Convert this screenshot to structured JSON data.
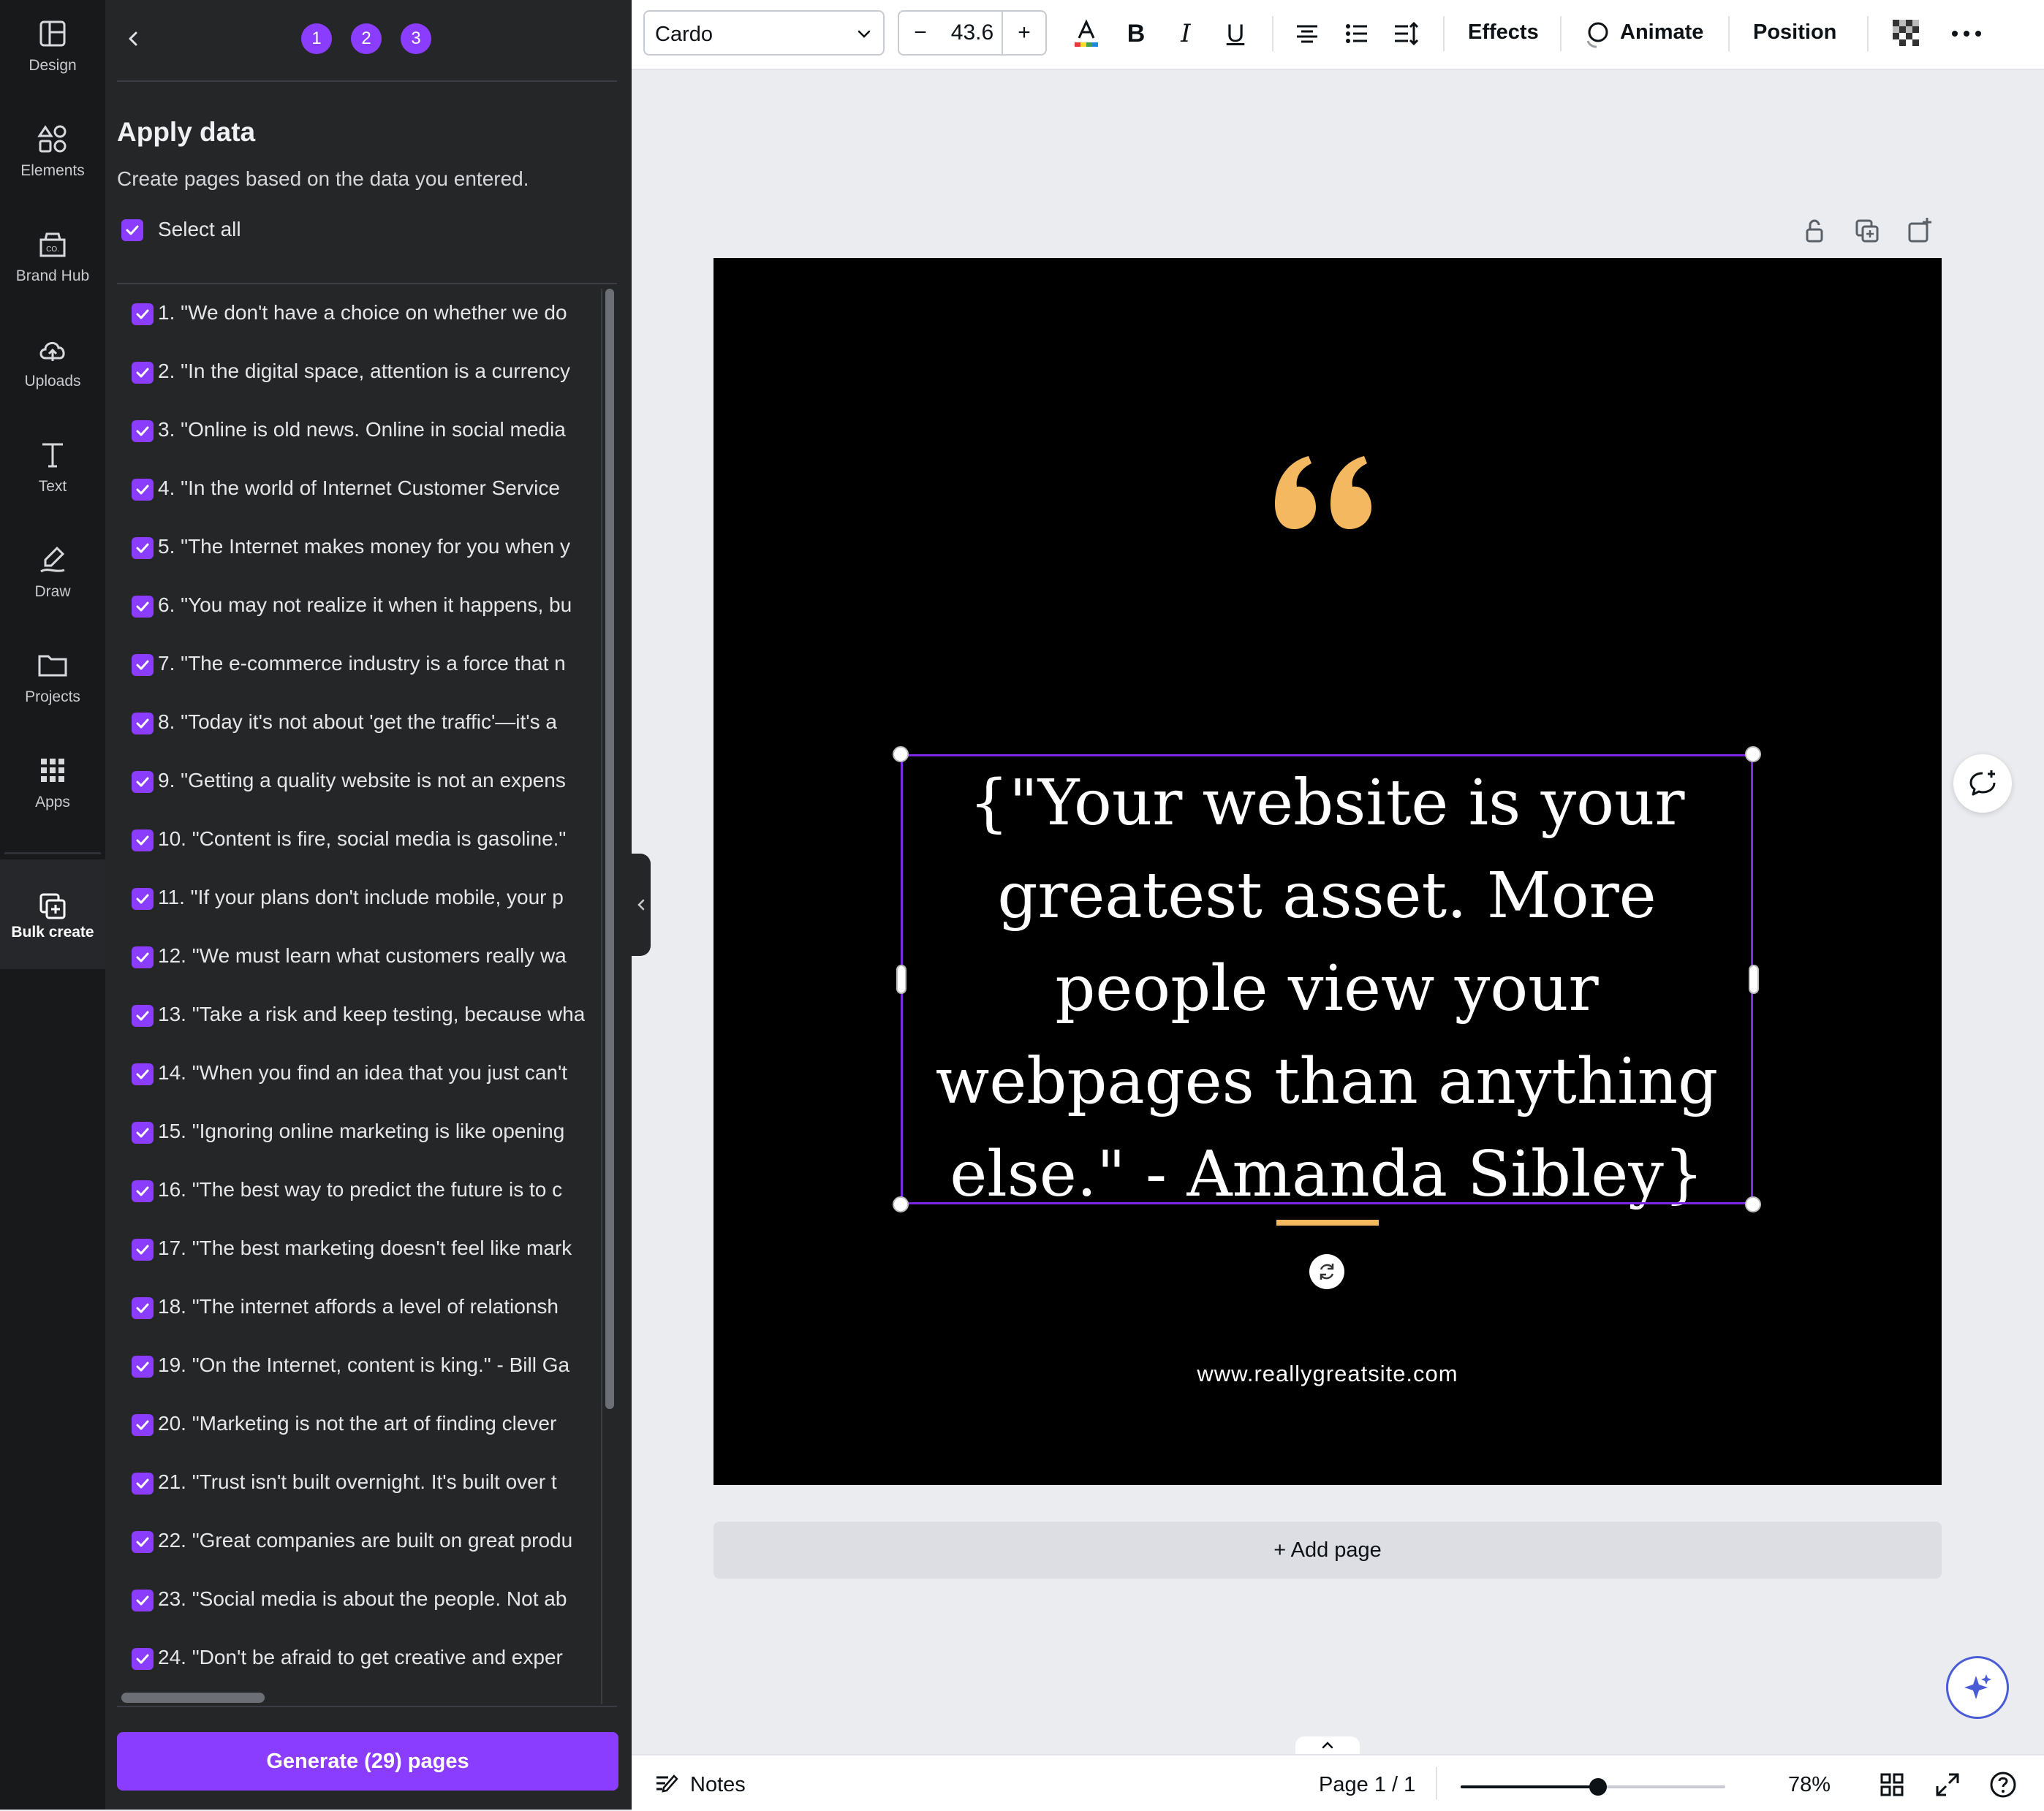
{
  "rail": {
    "items": [
      {
        "label": "Design",
        "icon": "design-layout-icon"
      },
      {
        "label": "Elements",
        "icon": "elements-shapes-icon"
      },
      {
        "label": "Brand Hub",
        "icon": "brand-hub-icon"
      },
      {
        "label": "Uploads",
        "icon": "cloud-upload-icon"
      },
      {
        "label": "Text",
        "icon": "text-t-icon"
      },
      {
        "label": "Draw",
        "icon": "pen-draw-icon"
      },
      {
        "label": "Projects",
        "icon": "folder-icon"
      },
      {
        "label": "Apps",
        "icon": "apps-grid-icon"
      }
    ],
    "active": {
      "label": "Bulk create",
      "icon": "bulk-create-icon"
    }
  },
  "panel": {
    "steps": [
      "1",
      "2",
      "3"
    ],
    "title": "Apply data",
    "subtitle": "Create pages based on the data you entered.",
    "select_all_label": "Select all",
    "rows": [
      "1. \"We don't have a choice on whether we do",
      "2. \"In the digital space, attention is a currency",
      "3. \"Online is old news. Online in social media",
      "4. \"In the world of Internet Customer Service",
      "5. \"The Internet makes money for you when y",
      "6. \"You may not realize it when it happens, bu",
      "7. \"The e-commerce industry is a force that n",
      "8. \"Today it's not about 'get the traffic'—it's a",
      "9. \"Getting a quality website is not an expens",
      "10. \"Content is fire, social media is gasoline.\"",
      "11. \"If your plans don't include mobile, your p",
      "12. \"We must learn what customers really wa",
      "13. \"Take a risk and keep testing, because wha",
      "14. \"When you find an idea that you just can't",
      "15. \"Ignoring online marketing is like opening",
      "16. \"The best way to predict the future is to c",
      "17. \"The best marketing doesn't feel like mark",
      "18. \"The internet affords a level of relationsh",
      "19. \"On the Internet, content is king.\" - Bill Ga",
      "20. \"Marketing is not the art of finding clever",
      "21. \"Trust isn't built overnight. It's built over t",
      "22. \"Great companies are built on great produ",
      "23. \"Social media is about the people. Not ab",
      "24. \"Don't be afraid to get creative and exper"
    ],
    "generate_label": "Generate (29) pages"
  },
  "toolbar": {
    "font": "Cardo",
    "font_size": "43.6",
    "minus": "−",
    "plus": "+",
    "bold": "B",
    "italic": "I",
    "underline": "U",
    "effects": "Effects",
    "animate": "Animate",
    "position": "Position"
  },
  "canvas": {
    "quote": "{\"Your website is your greatest asset. More people view your webpages than anything else.\" - Amanda Sibley}",
    "url": "www.reallygreatsite.com",
    "add_page": "+ Add page",
    "accent_color": "#f4b860",
    "selection_color": "#7d2ae8"
  },
  "bottombar": {
    "notes": "Notes",
    "page_indicator": "Page 1 / 1",
    "zoom": "78%",
    "zoom_level": 0.52
  },
  "colors": {
    "brand": "#8b3dff",
    "rail_bg": "#18191b",
    "panel_bg": "#252627"
  }
}
